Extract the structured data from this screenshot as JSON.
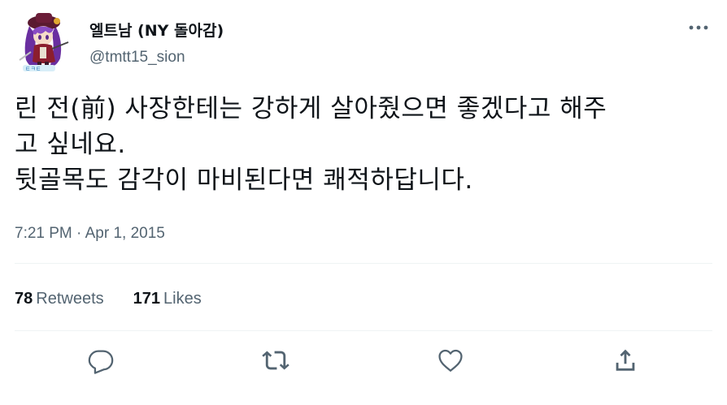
{
  "user": {
    "display_name": "엘트남 (NY 돌아감)",
    "handle": "@tmtt15_sion",
    "avatar_icon": "anime-character-avatar"
  },
  "tweet": {
    "lines": [
      "린 전(前) 사장한테는 강하게 살아줬으면 좋겠다고 해주",
      "고 싶네요.",
      "뒷골목도 감각이 마비된다면 쾌적하답니다."
    ],
    "timestamp": "7:21 PM · Apr 1, 2015"
  },
  "stats": {
    "retweets_count": "78",
    "retweets_label": "Retweets",
    "likes_count": "171",
    "likes_label": "Likes"
  },
  "actions": {
    "reply_icon": "reply-icon",
    "retweet_icon": "retweet-icon",
    "like_icon": "like-icon",
    "share_icon": "share-icon"
  },
  "colors": {
    "text_primary": "#0f1419",
    "text_secondary": "#536471",
    "divider": "#eff3f4",
    "avatar_hair": "#7b3fb0",
    "avatar_outfit": "#8b1e2e"
  }
}
